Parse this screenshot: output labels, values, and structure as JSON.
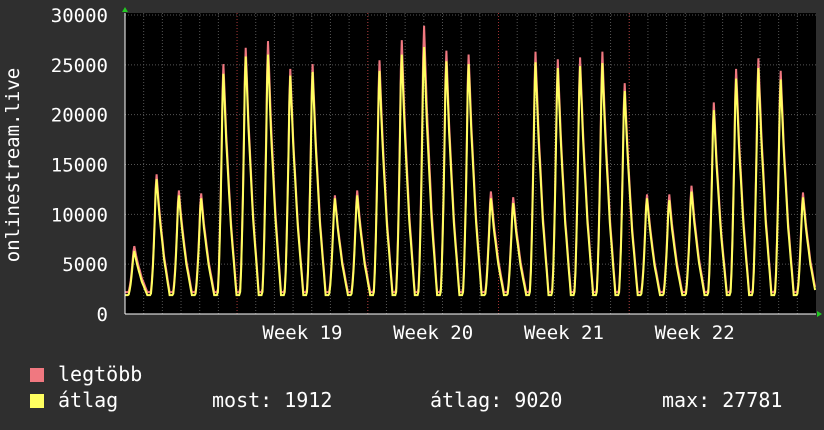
{
  "chart_data": {
    "type": "line",
    "ylabel": "onlinestream.live",
    "ylim": [
      0,
      30000
    ],
    "yticks": [
      0,
      5000,
      10000,
      15000,
      20000,
      25000,
      30000
    ],
    "xticks": [
      "Week 19",
      "Week 20",
      "Week 21",
      "Week 22"
    ],
    "days": 37,
    "grid": true,
    "colors": {
      "background": "#2f2f2f",
      "plot": "#000000",
      "grid": "#555555",
      "max_series": "#f07880",
      "avg_series": "#ffff60",
      "axis_arrow": "#22c922"
    },
    "daily_peaks": [
      {
        "max": 7000,
        "avg": 6500
      },
      {
        "max": 14500,
        "avg": 14000
      },
      {
        "max": 12800,
        "avg": 12300
      },
      {
        "max": 12500,
        "avg": 12000
      },
      {
        "max": 26000,
        "avg": 25000
      },
      {
        "max": 27700,
        "avg": 26800
      },
      {
        "max": 28400,
        "avg": 27000
      },
      {
        "max": 25500,
        "avg": 24800
      },
      {
        "max": 26000,
        "avg": 25200
      },
      {
        "max": 12300,
        "avg": 12000
      },
      {
        "max": 12800,
        "avg": 12300
      },
      {
        "max": 26400,
        "avg": 25300
      },
      {
        "max": 28500,
        "avg": 27000
      },
      {
        "max": 30000,
        "avg": 27800
      },
      {
        "max": 27400,
        "avg": 26300
      },
      {
        "max": 27000,
        "avg": 26000
      },
      {
        "max": 12700,
        "avg": 12000
      },
      {
        "max": 12100,
        "avg": 11500
      },
      {
        "max": 27300,
        "avg": 26200
      },
      {
        "max": 26500,
        "avg": 25600
      },
      {
        "max": 26700,
        "avg": 25800
      },
      {
        "max": 27300,
        "avg": 26100
      },
      {
        "max": 24000,
        "avg": 23200
      },
      {
        "max": 12400,
        "avg": 12000
      },
      {
        "max": 12400,
        "avg": 11800
      },
      {
        "max": 13300,
        "avg": 12700
      },
      {
        "max": 22000,
        "avg": 21200
      },
      {
        "max": 25500,
        "avg": 24500
      },
      {
        "max": 26600,
        "avg": 25600
      },
      {
        "max": 25300,
        "avg": 24400
      },
      {
        "max": 12600,
        "avg": 12100
      }
    ],
    "series": [
      {
        "name": "legtöbb"
      },
      {
        "name": "átlag"
      }
    ]
  },
  "legend": {
    "max_label": "legtöbb",
    "avg_label": "átlag"
  },
  "stats": {
    "now": "most: 1912",
    "avg": "átlag: 9020",
    "max": "max: 27781"
  }
}
